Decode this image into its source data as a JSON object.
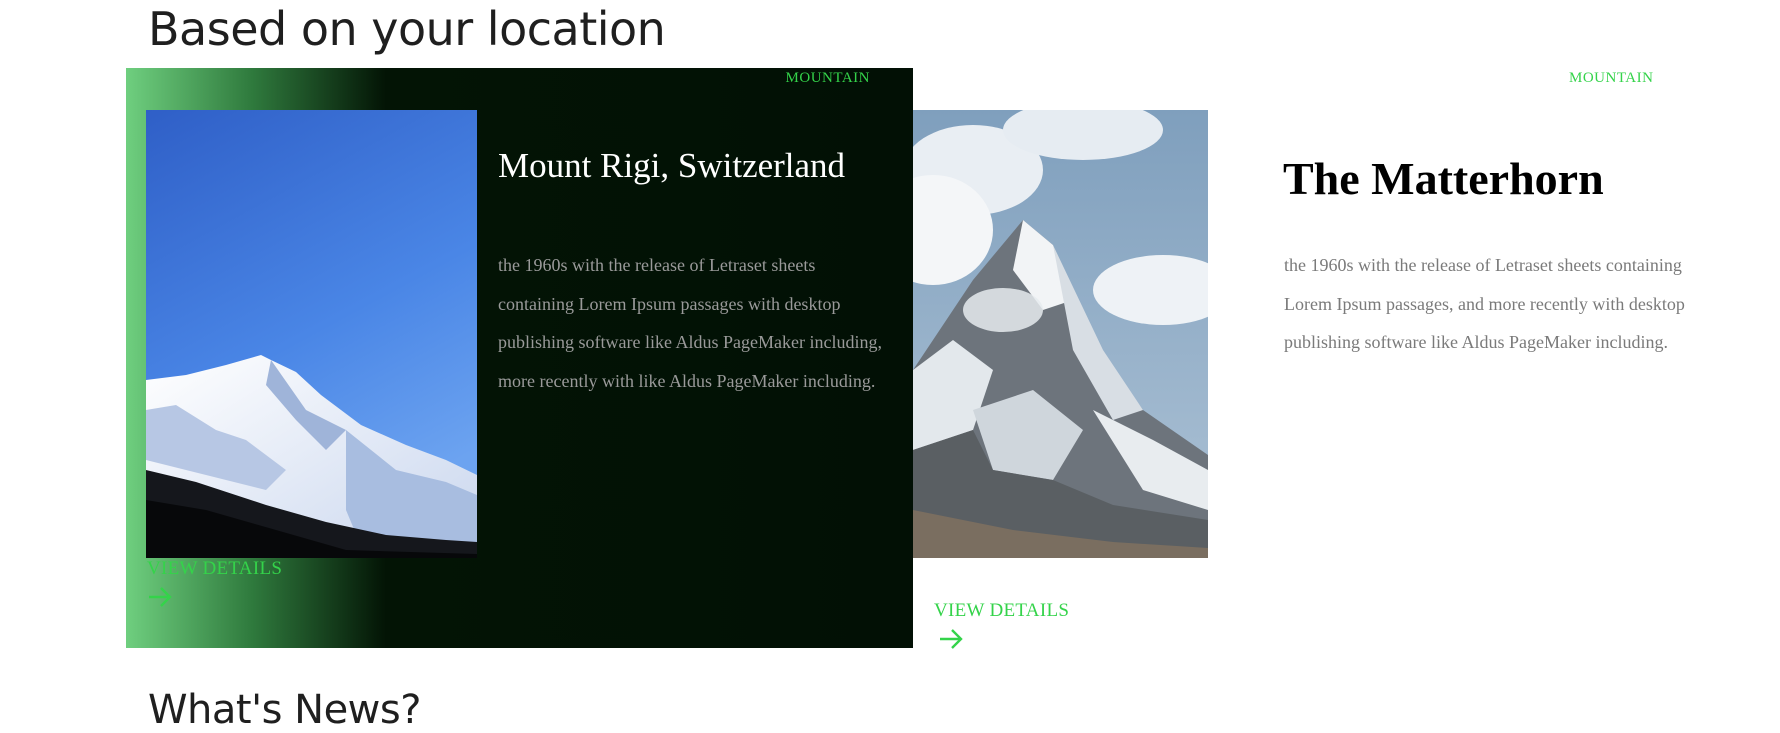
{
  "section_title": "Based on your location",
  "news_title": "What's News?",
  "cards": [
    {
      "tag": "MOUNTAIN",
      "title": "Mount Rigi, Switzerland",
      "description": "the 1960s with the release of Letraset sheets containing Lorem Ipsum passages with desktop publishing software like Aldus PageMaker including, more recently with like Aldus PageMaker including.",
      "link_label": "VIEW DETAILS",
      "arrow_icon": "arrow-right-icon",
      "image": "snowy-mountain-blue-sky"
    },
    {
      "tag": "MOUNTAIN",
      "title": "The Matterhorn",
      "description": "the 1960s with the release of Letraset sheets containing Lorem Ipsum passages, and more recently with desktop publishing software like Aldus PageMaker including.",
      "link_label": "VIEW DETAILS",
      "arrow_icon": "arrow-right-icon",
      "image": "matterhorn-cloudy-peak"
    }
  ],
  "colors": {
    "accent": "#34d34a",
    "card_dark_bg": "#021005",
    "card_dark_gradient_start": "#6fcf7f"
  }
}
